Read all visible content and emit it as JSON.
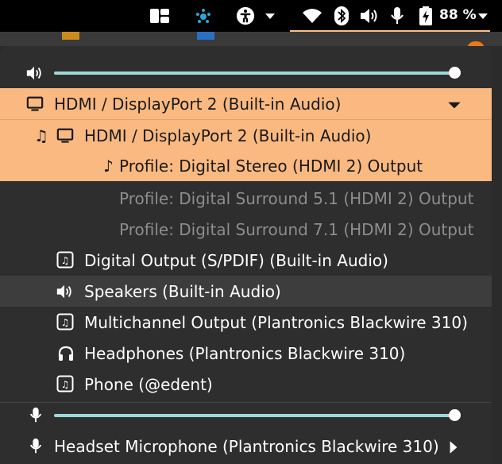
{
  "panel": {
    "icons": [
      "workspaces-icon",
      "network-app-icon",
      "accessibility-icon",
      "chevron-down-icon",
      "wifi-icon",
      "bluetooth-icon",
      "volume-icon",
      "microphone-icon",
      "battery-icon",
      "chevron-down-icon"
    ],
    "battery_label": "88 %"
  },
  "output": {
    "volume_level": 1.0,
    "device_selected": "HDMI / DisplayPort 2 (Built-in Audio)",
    "submenu_device": "HDMI / DisplayPort 2 (Built-in Audio)",
    "profiles": [
      {
        "label": "Profile: Digital Stereo (HDMI 2) Output",
        "active": true
      },
      {
        "label": "Profile: Digital Surround 5.1 (HDMI 2) Output",
        "active": false
      },
      {
        "label": "Profile: Digital Surround 7.1 (HDMI 2) Output",
        "active": false
      }
    ],
    "other_devices": [
      {
        "label": "Digital Output (S/PDIF) (Built-in Audio)",
        "icon": "audio-card-icon"
      },
      {
        "label": "Speakers (Built-in Audio)",
        "icon": "speaker-icon"
      },
      {
        "label": "Multichannel Output (Plantronics Blackwire 310)",
        "icon": "audio-card-icon"
      },
      {
        "label": "Headphones (Plantronics Blackwire 310)",
        "icon": "headphones-icon"
      },
      {
        "label": "Phone (@edent)",
        "icon": "audio-card-icon"
      }
    ]
  },
  "input": {
    "volume_level": 1.0,
    "device_selected": "Headset Microphone (Plantronics Blackwire 310)"
  },
  "colors": {
    "highlight": "#f9b980",
    "slider": "#9fd8d8",
    "menu_bg": "#2e2e2e",
    "panel_bg": "#000000"
  }
}
